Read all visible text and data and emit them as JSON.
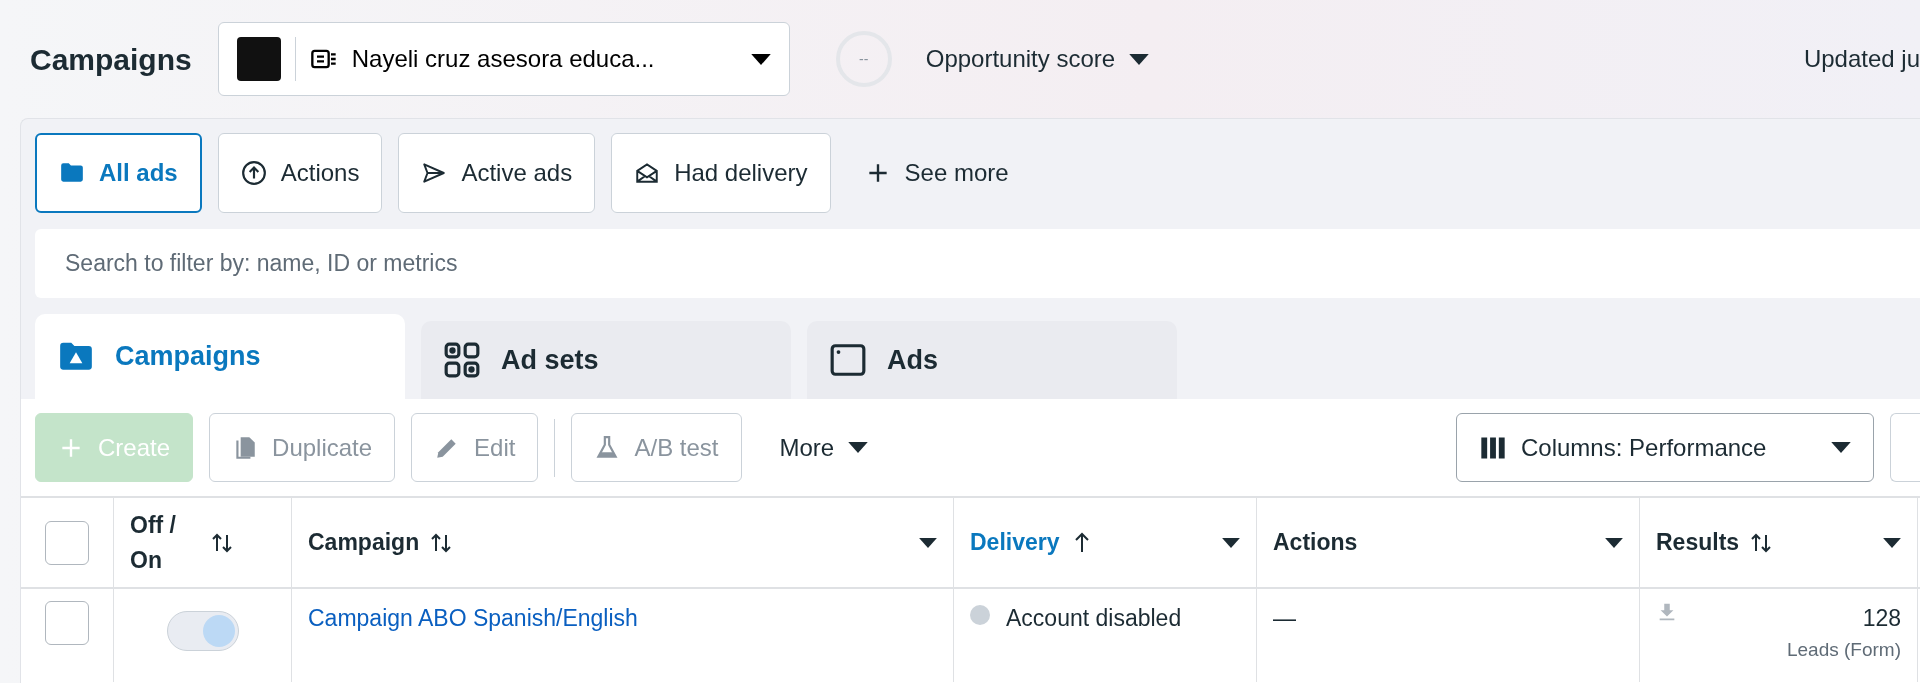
{
  "header": {
    "title": "Campaigns",
    "account": {
      "name": "Nayeli cruz asesora educa..."
    },
    "opportunity": {
      "score": "--",
      "label": "Opportunity score"
    },
    "updated": "Updated ju"
  },
  "filters": [
    {
      "label": "All ads",
      "selected": true
    },
    {
      "label": "Actions",
      "selected": false
    },
    {
      "label": "Active ads",
      "selected": false
    },
    {
      "label": "Had delivery",
      "selected": false
    }
  ],
  "see_more": "See more",
  "search": {
    "placeholder": "Search to filter by: name, ID or metrics"
  },
  "tabs": [
    {
      "label": "Campaigns",
      "selected": true
    },
    {
      "label": "Ad sets",
      "selected": false
    },
    {
      "label": "Ads",
      "selected": false
    }
  ],
  "toolbar": [
    {
      "label": "Create",
      "kind": "primary",
      "disabled": true
    },
    {
      "label": "Duplicate",
      "kind": "outline",
      "disabled": true
    },
    {
      "label": "Edit",
      "kind": "outline",
      "disabled": true
    },
    {
      "label": "A/B test",
      "kind": "outline",
      "disabled": true
    },
    {
      "label": "More",
      "kind": "menu",
      "disabled": false
    }
  ],
  "columns_button": "Columns: Performance",
  "table": {
    "select_all_checked": false,
    "columns": [
      {
        "label": "Off / On",
        "kind": "toggle",
        "sortable": true,
        "sorted": false
      },
      {
        "label": "Campaign",
        "kind": "data",
        "sortable": true,
        "sorted": false
      },
      {
        "label": "Delivery",
        "kind": "data",
        "sortable": true,
        "sorted": true
      },
      {
        "label": "Actions",
        "kind": "data",
        "sortable": false,
        "sorted": false
      },
      {
        "label": "Results",
        "kind": "data",
        "sortable": true,
        "sorted": false
      }
    ],
    "rows": [
      {
        "checked": false,
        "on": true,
        "disabled": true,
        "campaign": "Campaign ABO Spanish/English",
        "delivery": "Account disabled",
        "color": "#cbd2d9",
        "actions": "—",
        "results": "128",
        "result_type": "Leads (Form)"
      }
    ]
  }
}
